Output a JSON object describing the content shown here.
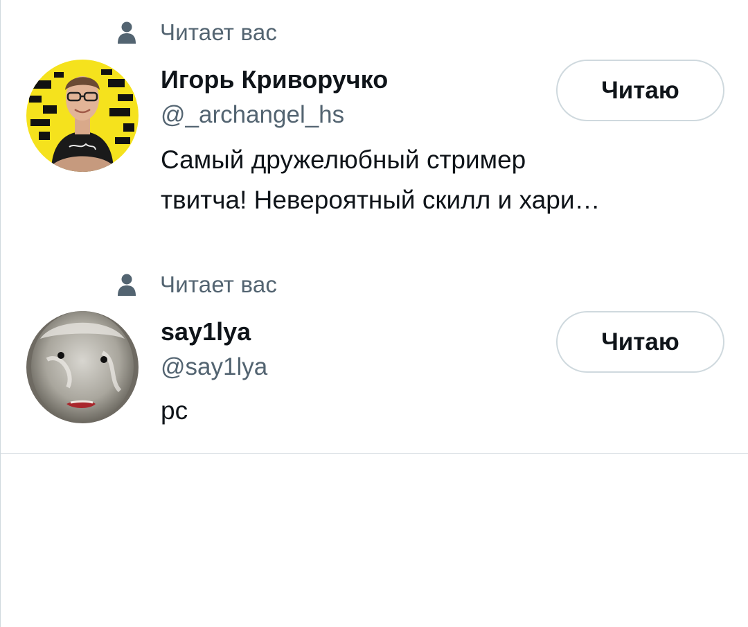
{
  "users": [
    {
      "follows_you": "Читает вас",
      "name": "Игорь Криворучко",
      "handle": "@_archangel_hs",
      "bio_line1": "Самый дружелюбный стример",
      "bio_line2": "твитча! Невероятный скилл и хари…",
      "button_label": "Читаю"
    },
    {
      "follows_you": "Читает вас",
      "name": "say1lya",
      "handle": "@say1lya",
      "bio_line1": "pc",
      "button_label": "Читаю"
    }
  ],
  "colors": {
    "primary_text": "#0f1419",
    "secondary_text": "#536471",
    "border": "#cfd9de",
    "avatar1_bg": "#f5e21d"
  },
  "icons": {
    "follows_indicator": "person-icon"
  }
}
